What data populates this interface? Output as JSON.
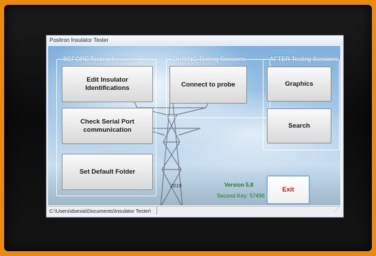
{
  "window": {
    "title": "Positron Insulator Tester"
  },
  "groups": {
    "before": {
      "label": "BEFORE Testing Sessions",
      "buttons": {
        "edit": "Edit Insulator Identifications",
        "check": "Check Serial Port communication",
        "default_folder": "Set Default Folder"
      }
    },
    "during": {
      "label": "DURING Testing Sessions",
      "buttons": {
        "connect": "Connect to probe"
      }
    },
    "after": {
      "label": "AFTER Testing Sessions",
      "buttons": {
        "graphics": "Graphics",
        "search": "Search"
      }
    }
  },
  "footer": {
    "year": "2018",
    "version": "Version 5.8",
    "second_key": "Second Key: 57496",
    "exit_label": "Exit"
  },
  "statusbar": {
    "path": "C:\\Users\\dsesia\\Documents\\Insulator Tester\\"
  },
  "colors": {
    "frame": "#e98a12",
    "exit_text": "#d31414",
    "version_text": "#1f7a1f"
  }
}
